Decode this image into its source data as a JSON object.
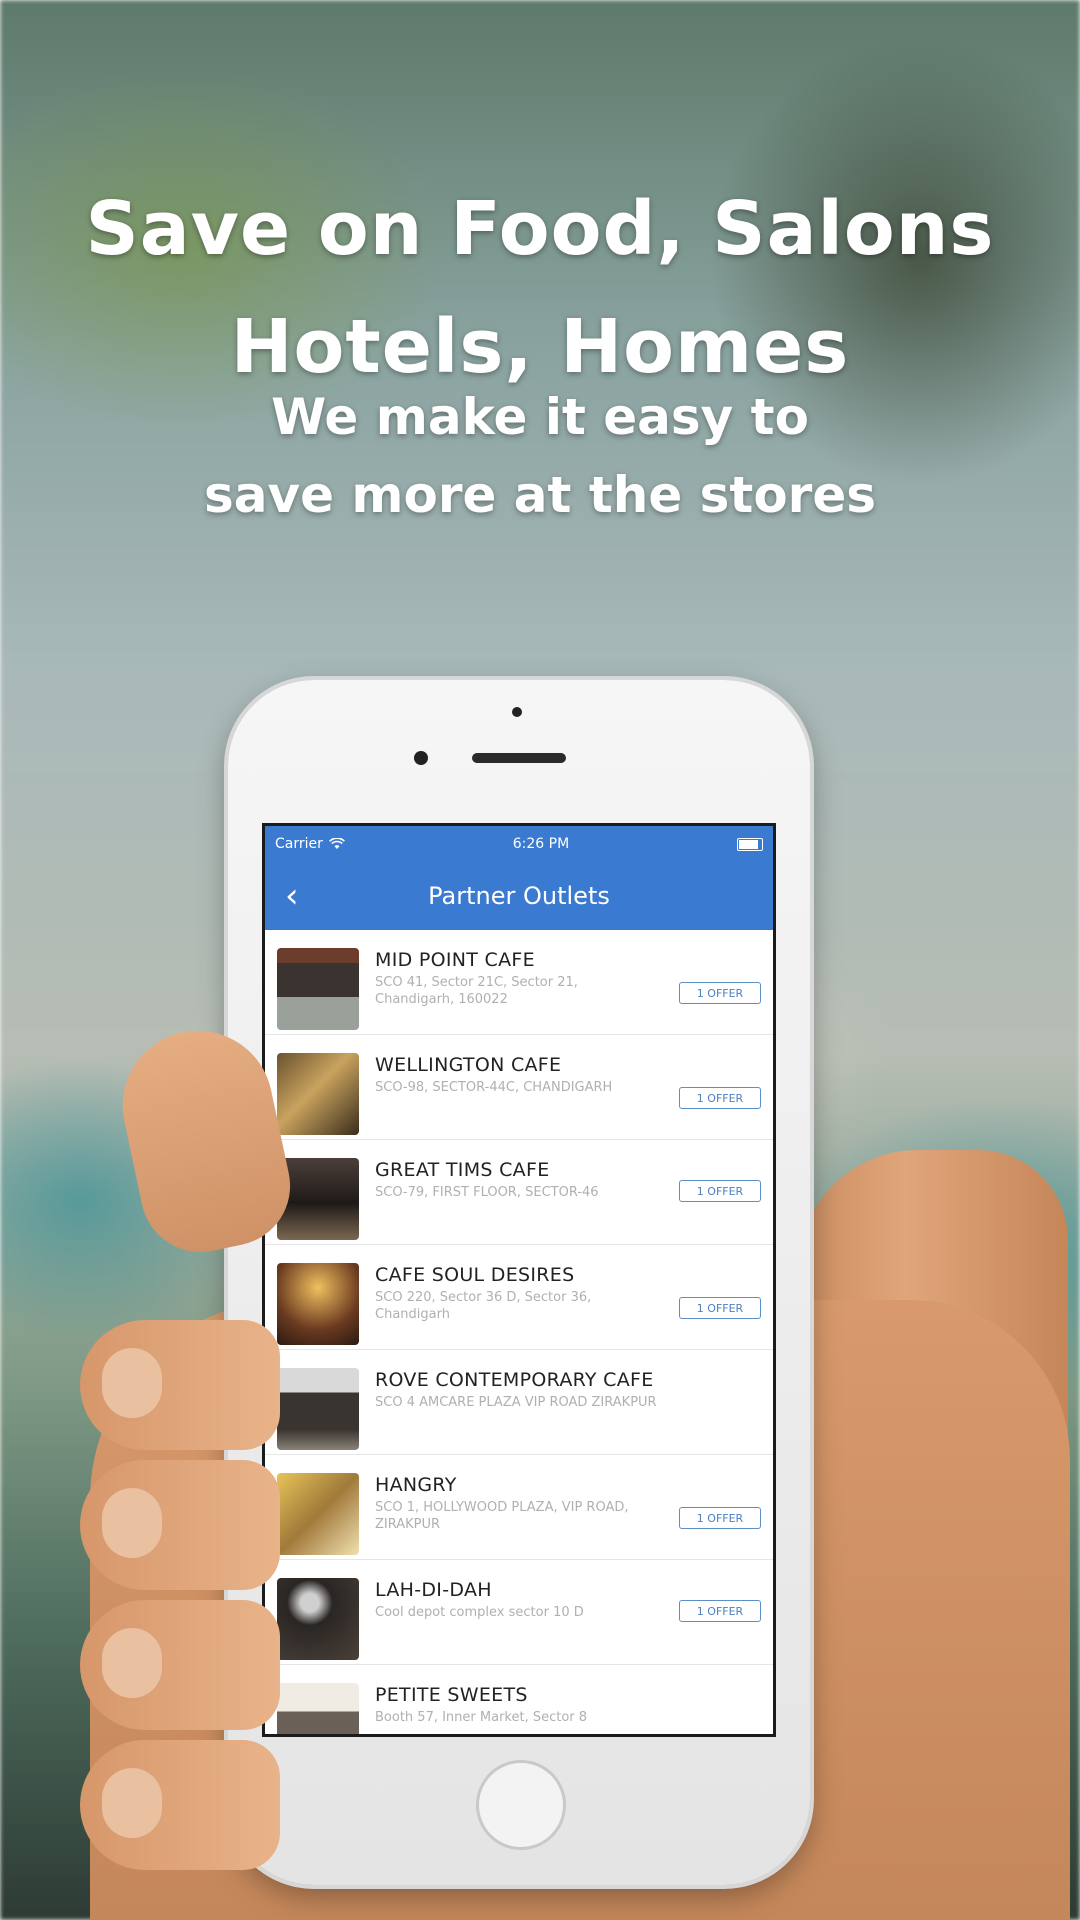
{
  "headline": {
    "line1": "Save on Food, Salons",
    "line2": "Hotels, Homes",
    "sub1": "We make it easy to",
    "sub2": "save more at the stores"
  },
  "status_bar": {
    "carrier": "Carrier",
    "time": "6:26 PM"
  },
  "nav": {
    "title": "Partner Outlets",
    "back_icon": "chevron-left-icon"
  },
  "outlets": [
    {
      "name": "MID POINT CAFE",
      "address": "SCO 41, Sector 21C, Sector 21, Chandigarh, 160022",
      "offer": "1 OFFER"
    },
    {
      "name": "WELLINGTON CAFE",
      "address": "SCO-98, SECTOR-44C, CHANDIGARH",
      "offer": "1 OFFER"
    },
    {
      "name": "GREAT TIMS CAFE",
      "address": "SCO-79, FIRST FLOOR, SECTOR-46",
      "offer": "1 OFFER"
    },
    {
      "name": "CAFE SOUL DESIRES",
      "address": "SCO 220, Sector 36 D, Sector 36, Chandigarh",
      "offer": "1 OFFER"
    },
    {
      "name": "ROVE CONTEMPORARY CAFE",
      "address": "SCO 4 AMCARE PLAZA VIP ROAD ZIRAKPUR",
      "offer": ""
    },
    {
      "name": "HANGRY",
      "address": "SCO 1, HOLLYWOOD PLAZA, VIP ROAD, ZIRAKPUR",
      "offer": "1 OFFER"
    },
    {
      "name": "LAH-DI-DAH",
      "address": "Cool depot complex sector 10 D",
      "offer": "1 OFFER"
    },
    {
      "name": "PETITE SWEETS",
      "address": "Booth 57, Inner Market, Sector 8",
      "offer": ""
    }
  ],
  "colors": {
    "nav_blue": "#3b7ad1",
    "offer_border": "#5b8fc8"
  }
}
